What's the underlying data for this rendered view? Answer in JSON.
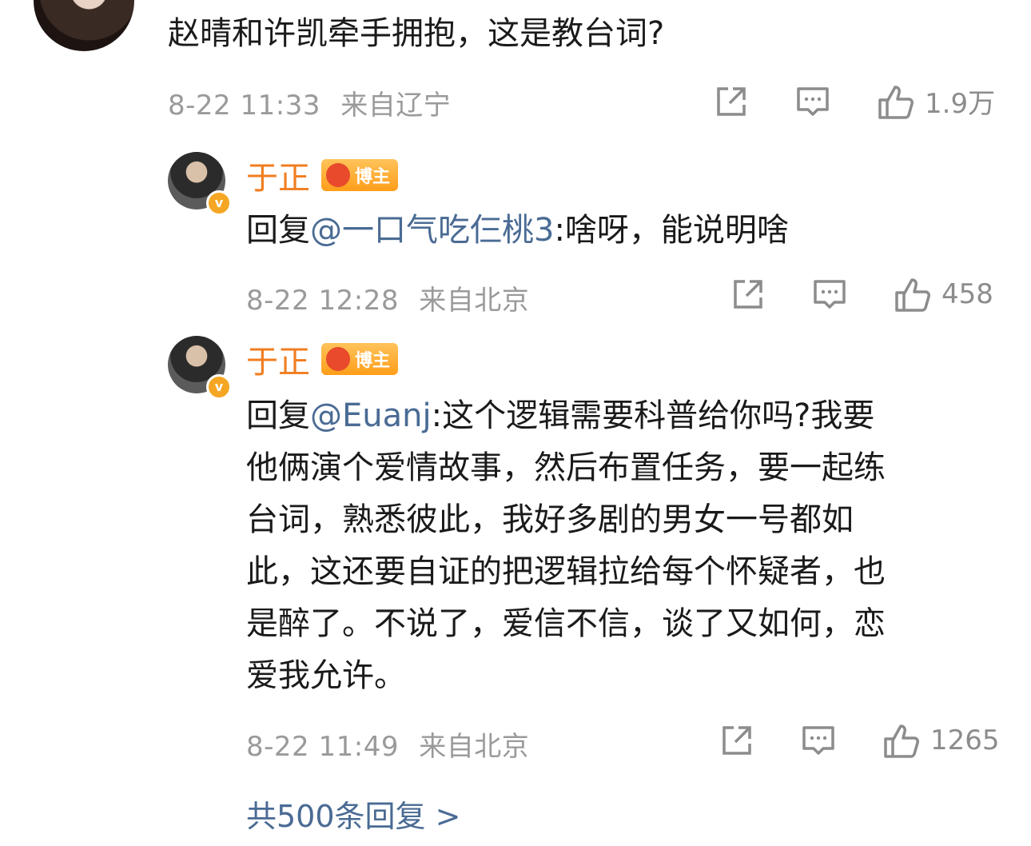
{
  "main_comment": {
    "text": "赵晴和许凯牵手拥抱，这是教台词?",
    "time": "8-22 11:33",
    "location": "来自辽宁",
    "likes": "1.9万"
  },
  "replies": [
    {
      "username": "于正",
      "badge": "博主",
      "reply_prefix": "回复",
      "mention": "@一口气吃仨桃3",
      "text": ":啥呀，能说明啥",
      "time": "8-22 12:28",
      "location": "来自北京",
      "likes": "458"
    },
    {
      "username": "于正",
      "badge": "博主",
      "reply_prefix": "回复",
      "mention": "@Euanj",
      "text_line1": ":这个逻辑需要科普给你吗?我要",
      "text_line2": "他俩演个爱情故事，然后布置任务，要一起练",
      "text_line3": "台词，熟悉彼此，我好多剧的男女一号都如",
      "text_line4": "此，这还要自证的把逻辑拉给每个怀疑者，也",
      "text_line5": "是醉了。不说了，爱信不信，谈了又如何，恋",
      "text_line6": "爱我允许。",
      "time": "8-22 11:49",
      "location": "来自北京",
      "likes": "1265"
    }
  ],
  "more_replies": "共500条回复 >",
  "icons": {
    "share": "share-icon",
    "comment": "comment-icon",
    "like": "thumbs-up-icon",
    "verified": "verified-v-icon"
  },
  "colors": {
    "username": "#f07d20",
    "link": "#4a6b94",
    "meta": "#9a9a9a"
  },
  "verified_mark": "v"
}
